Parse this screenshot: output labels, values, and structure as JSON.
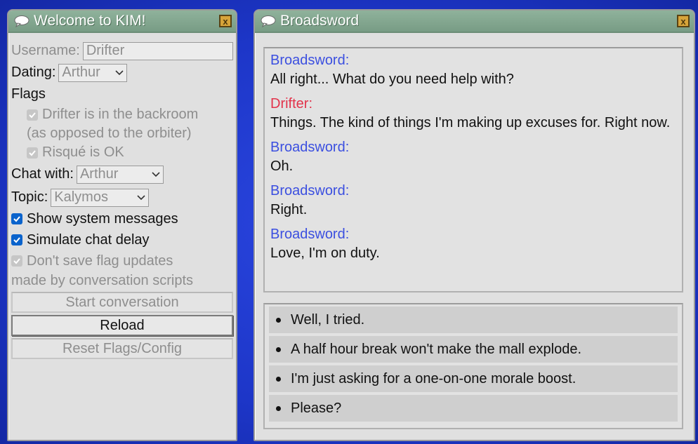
{
  "kim": {
    "title": "Welcome to KIM!",
    "close_label": "x",
    "username": {
      "label": "Username:",
      "value": "Drifter"
    },
    "dating": {
      "label": "Dating:",
      "value": "Arthur"
    },
    "flags_heading": "Flags",
    "flags": {
      "backroom_line1": "Drifter is in the backroom",
      "backroom_line2": "(as opposed to the orbiter)",
      "risque": "Risqué is OK"
    },
    "chat_with": {
      "label": "Chat with:",
      "value": "Arthur"
    },
    "topic": {
      "label": "Topic:",
      "value": "Kalymos"
    },
    "show_system": "Show system messages",
    "simulate_delay": "Simulate chat delay",
    "dont_save_line1": "Don't save flag updates",
    "dont_save_line2": "made by conversation scripts",
    "buttons": {
      "start": "Start conversation",
      "reload": "Reload",
      "reset": "Reset Flags/Config"
    }
  },
  "chat": {
    "title": "Broadsword",
    "close_label": "x",
    "messages": [
      {
        "speaker": "Broadsword:",
        "text": "All right... What do you need help with?"
      },
      {
        "speaker": "Drifter:",
        "text": "Things. The kind of things I'm making up excuses for. Right now."
      },
      {
        "speaker": "Broadsword:",
        "text": "Oh."
      },
      {
        "speaker": "Broadsword:",
        "text": "Right."
      },
      {
        "speaker": "Broadsword:",
        "text": "Love, I'm on duty."
      }
    ],
    "choices": [
      "Well, I tried.",
      "A half hour break won't make the mall explode.",
      "I'm just asking for a one-on-one morale boost.",
      "Please?"
    ]
  },
  "colors": {
    "desktop": "#1d36c8",
    "titlebar": "#819f8b",
    "speaker_broadsword": "#3b4fe0",
    "speaker_drifter": "#e2334b",
    "checkbox_checked": "#0a63cc",
    "close_button": "#d7a43a"
  },
  "icons": {
    "title": "speech-bubble-icon",
    "close": "close-icon",
    "dropdown": "chevron-down-icon",
    "check": "check-icon",
    "bullet": "bullet-icon"
  }
}
